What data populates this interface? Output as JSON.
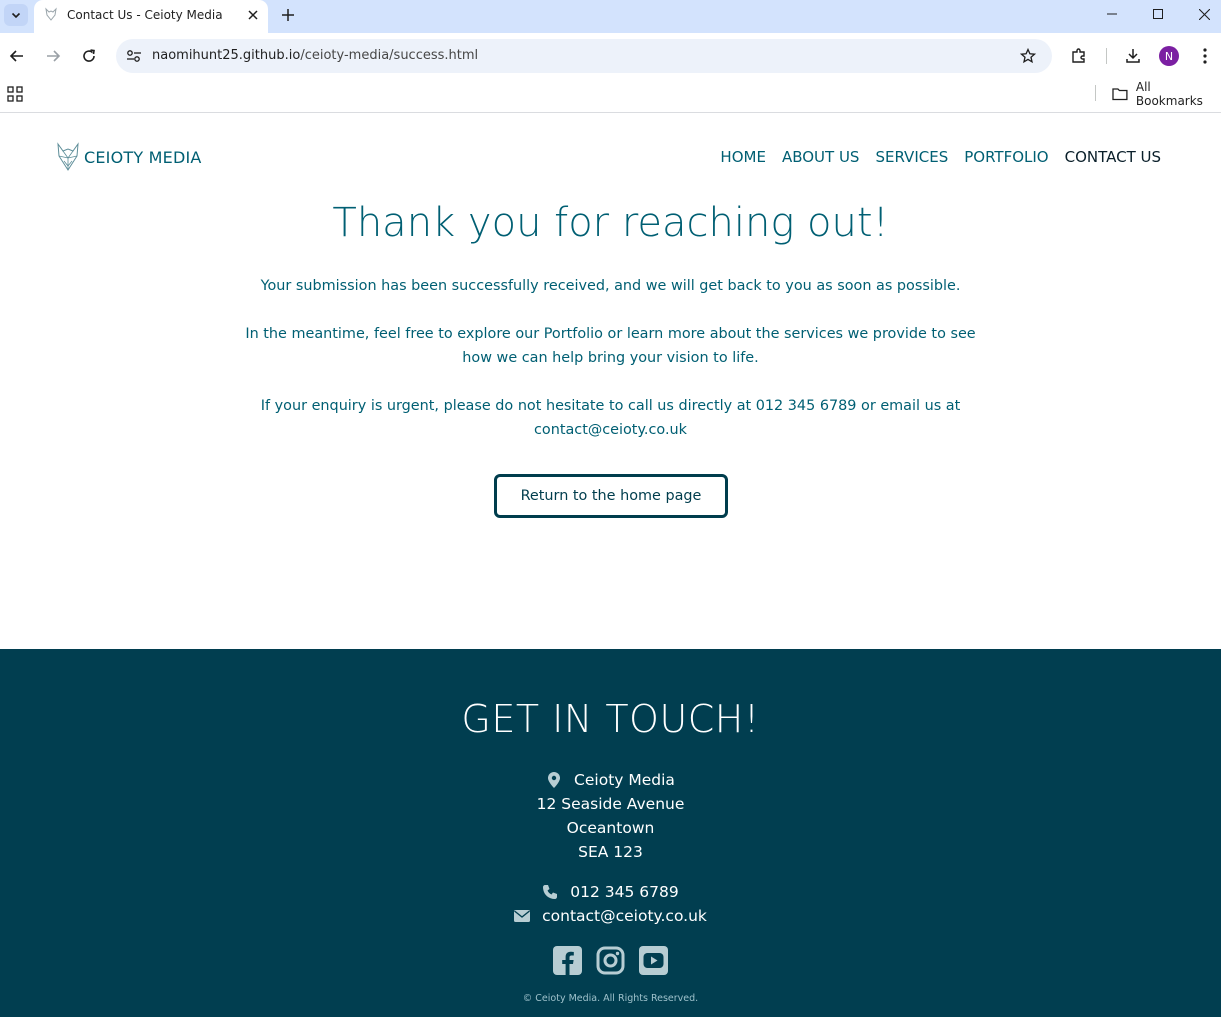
{
  "browser": {
    "tab_title": "Contact Us - Ceioty Media",
    "url_host": "naomihunt25.github.io",
    "url_path": "/ceioty-media/success.html",
    "avatar_initial": "N",
    "all_bookmarks_label": "All Bookmarks"
  },
  "site": {
    "brand": "CEIOTY MEDIA",
    "nav": [
      {
        "label": "HOME"
      },
      {
        "label": "ABOUT US"
      },
      {
        "label": "SERVICES"
      },
      {
        "label": "PORTFOLIO"
      },
      {
        "label": "CONTACT US"
      }
    ],
    "active_nav": "CONTACT US"
  },
  "success": {
    "title": "Thank you for reaching out!",
    "para1": "Your submission has been successfully received, and we will get back to you as soon as possible.",
    "para2": "In the meantime, feel free to explore our Portfolio or learn more about the services we provide to see how we can help bring your vision to life.",
    "para3": "If your enquiry is urgent, please do not hesitate to call us directly at 012 345 6789 or email us at contact@ceioty.co.uk",
    "button_label": "Return to the home page"
  },
  "footer": {
    "title": "GET IN TOUCH!",
    "company": "Ceioty Media",
    "street": "12 Seaside Avenue",
    "town": "Oceantown",
    "postcode": "SEA 123",
    "phone": "012 345 6789",
    "email": "contact@ceioty.co.uk",
    "social_icons": [
      "facebook-icon",
      "instagram-icon",
      "youtube-icon"
    ],
    "copyright": "© Ceioty Media. All Rights Reserved."
  },
  "colors": {
    "brand_teal": "#005f73",
    "footer_bg": "#013e50",
    "tabstrip_bg": "#d3e3fd"
  }
}
